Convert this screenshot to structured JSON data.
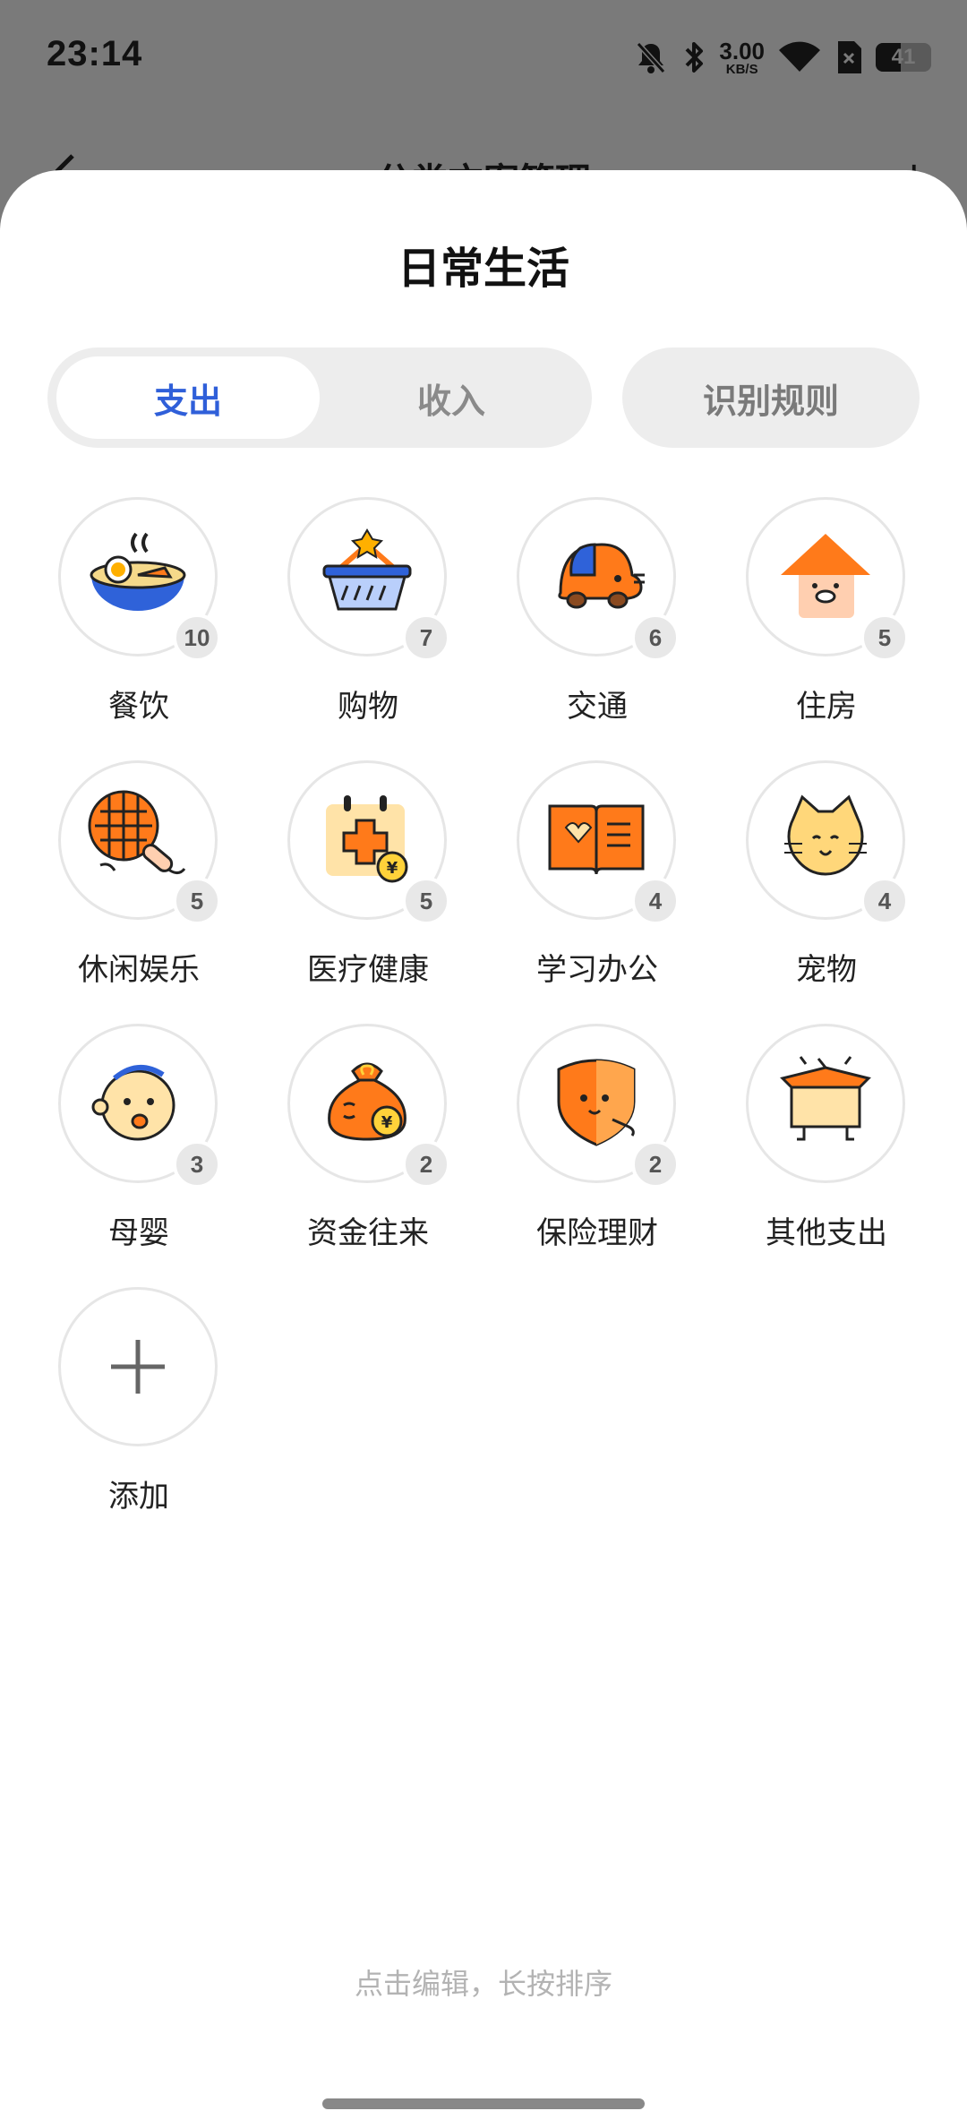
{
  "status_bar": {
    "time": "23:14",
    "net_speed_value": "3.00",
    "net_speed_unit": "KB/S",
    "battery_level": "41",
    "icons": [
      "bell-off-icon",
      "bluetooth-icon",
      "wifi-icon",
      "sim-off-icon",
      "battery-icon"
    ]
  },
  "background_page": {
    "title": "分类方案管理"
  },
  "sheet": {
    "title": "日常生活",
    "tabs": [
      {
        "label": "支出",
        "active": true
      },
      {
        "label": "收入",
        "active": false
      }
    ],
    "rules_button": "识别规则",
    "categories": [
      {
        "label": "餐饮",
        "count": "10",
        "icon": "noodle-bowl-icon"
      },
      {
        "label": "购物",
        "count": "7",
        "icon": "shopping-basket-icon"
      },
      {
        "label": "交通",
        "count": "6",
        "icon": "car-icon"
      },
      {
        "label": "住房",
        "count": "5",
        "icon": "house-icon"
      },
      {
        "label": "休闲娱乐",
        "count": "5",
        "icon": "racket-icon"
      },
      {
        "label": "医疗健康",
        "count": "5",
        "icon": "medical-calendar-icon"
      },
      {
        "label": "学习办公",
        "count": "4",
        "icon": "open-book-icon"
      },
      {
        "label": "宠物",
        "count": "4",
        "icon": "cat-icon"
      },
      {
        "label": "母婴",
        "count": "3",
        "icon": "baby-icon"
      },
      {
        "label": "资金往来",
        "count": "2",
        "icon": "money-bag-icon"
      },
      {
        "label": "保险理财",
        "count": "2",
        "icon": "shield-icon"
      },
      {
        "label": "其他支出",
        "count": "",
        "icon": "open-box-icon"
      },
      {
        "label": "添加",
        "count": "",
        "icon": "plus-icon"
      }
    ],
    "hint": "点击编辑，长按排序"
  },
  "colors": {
    "accent": "#2f5fd9",
    "orange": "#ff7a1a",
    "badge_bg": "#e8e8e8"
  }
}
